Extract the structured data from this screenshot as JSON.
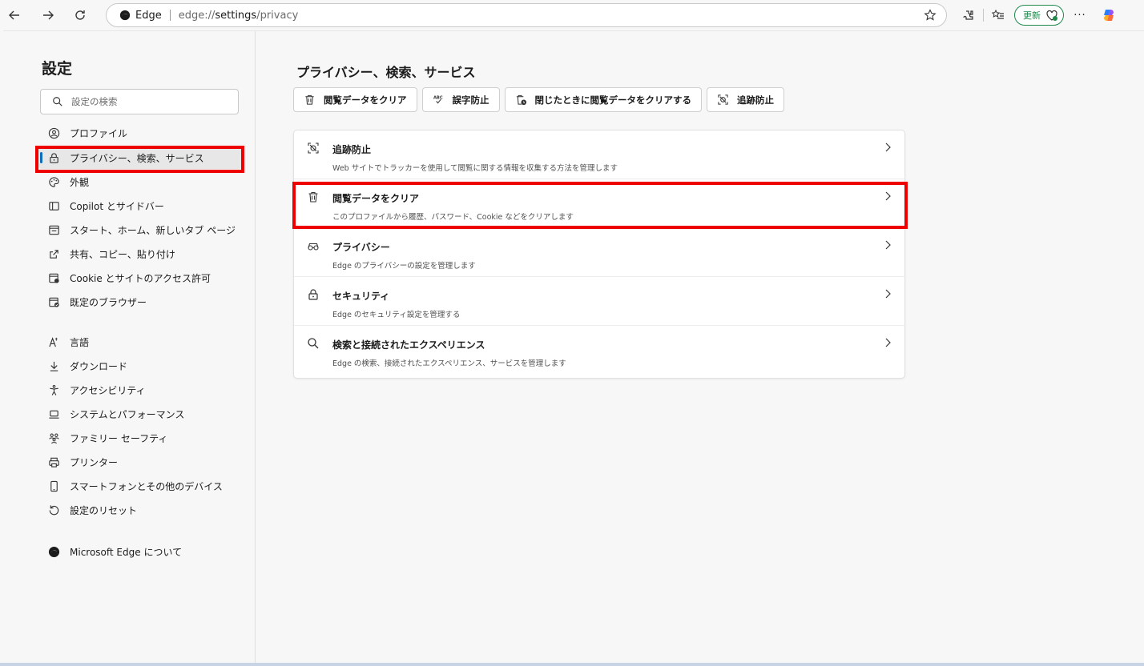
{
  "browser": {
    "address": {
      "site": "Edge",
      "url_prefix": "edge://",
      "url_path": "settings",
      "url_suffix": "/privacy"
    },
    "update_label": "更新",
    "more_label": "···"
  },
  "sidebar": {
    "title": "設定",
    "search_placeholder": "設定の検索",
    "items": [
      {
        "label": "プロファイル",
        "icon": "profile-icon"
      },
      {
        "label": "プライバシー、検索、サービス",
        "icon": "lock-icon",
        "active": true
      },
      {
        "label": "外観",
        "icon": "palette-icon"
      },
      {
        "label": "Copilot とサイドバー",
        "icon": "sidebar-icon"
      },
      {
        "label": "スタート、ホーム、新しいタブ ページ",
        "icon": "home-icon"
      },
      {
        "label": "共有、コピー、貼り付け",
        "icon": "share-icon"
      },
      {
        "label": "Cookie とサイトのアクセス許可",
        "icon": "cookie-icon"
      },
      {
        "label": "既定のブラウザー",
        "icon": "browser-icon"
      },
      {
        "label": "言語",
        "icon": "language-icon"
      },
      {
        "label": "ダウンロード",
        "icon": "download-icon"
      },
      {
        "label": "アクセシビリティ",
        "icon": "accessibility-icon"
      },
      {
        "label": "システムとパフォーマンス",
        "icon": "laptop-icon"
      },
      {
        "label": "ファミリー セーフティ",
        "icon": "family-icon"
      },
      {
        "label": "プリンター",
        "icon": "printer-icon"
      },
      {
        "label": "スマートフォンとその他のデバイス",
        "icon": "phone-icon"
      },
      {
        "label": "設定のリセット",
        "icon": "reset-icon"
      },
      {
        "label": "Microsoft Edge について",
        "icon": "edge-logo-icon"
      }
    ]
  },
  "main": {
    "title": "プライバシー、検索、サービス",
    "chips": [
      {
        "label": "閲覧データをクリア",
        "icon": "trash-icon"
      },
      {
        "label": "誤字防止",
        "icon": "spellcheck-icon"
      },
      {
        "label": "閉じたときに閲覧データをクリアする",
        "icon": "trash-clock-icon"
      },
      {
        "label": "追跡防止",
        "icon": "tracking-icon"
      }
    ],
    "rows": [
      {
        "title": "追跡防止",
        "desc": "Web サイトでトラッカーを使用して閲覧に関する情報を収集する方法を管理します",
        "icon": "tracking-icon"
      },
      {
        "title": "閲覧データをクリア",
        "desc": "このプロファイルから履歴、パスワード、Cookie などをクリアします",
        "icon": "trash-icon"
      },
      {
        "title": "プライバシー",
        "desc": "Edge のプライバシーの設定を管理します",
        "icon": "glasses-icon"
      },
      {
        "title": "セキュリティ",
        "desc": "Edge のセキュリティ設定を管理する",
        "icon": "lock-icon"
      },
      {
        "title": "検索と接続されたエクスペリエンス",
        "desc": "Edge の検索、接続されたエクスペリエンス、サービスを管理します",
        "icon": "search-icon"
      }
    ]
  },
  "colors": {
    "highlight": "#ee0000",
    "accent": "#0f6cbd",
    "update_green": "#1f8a4c"
  }
}
